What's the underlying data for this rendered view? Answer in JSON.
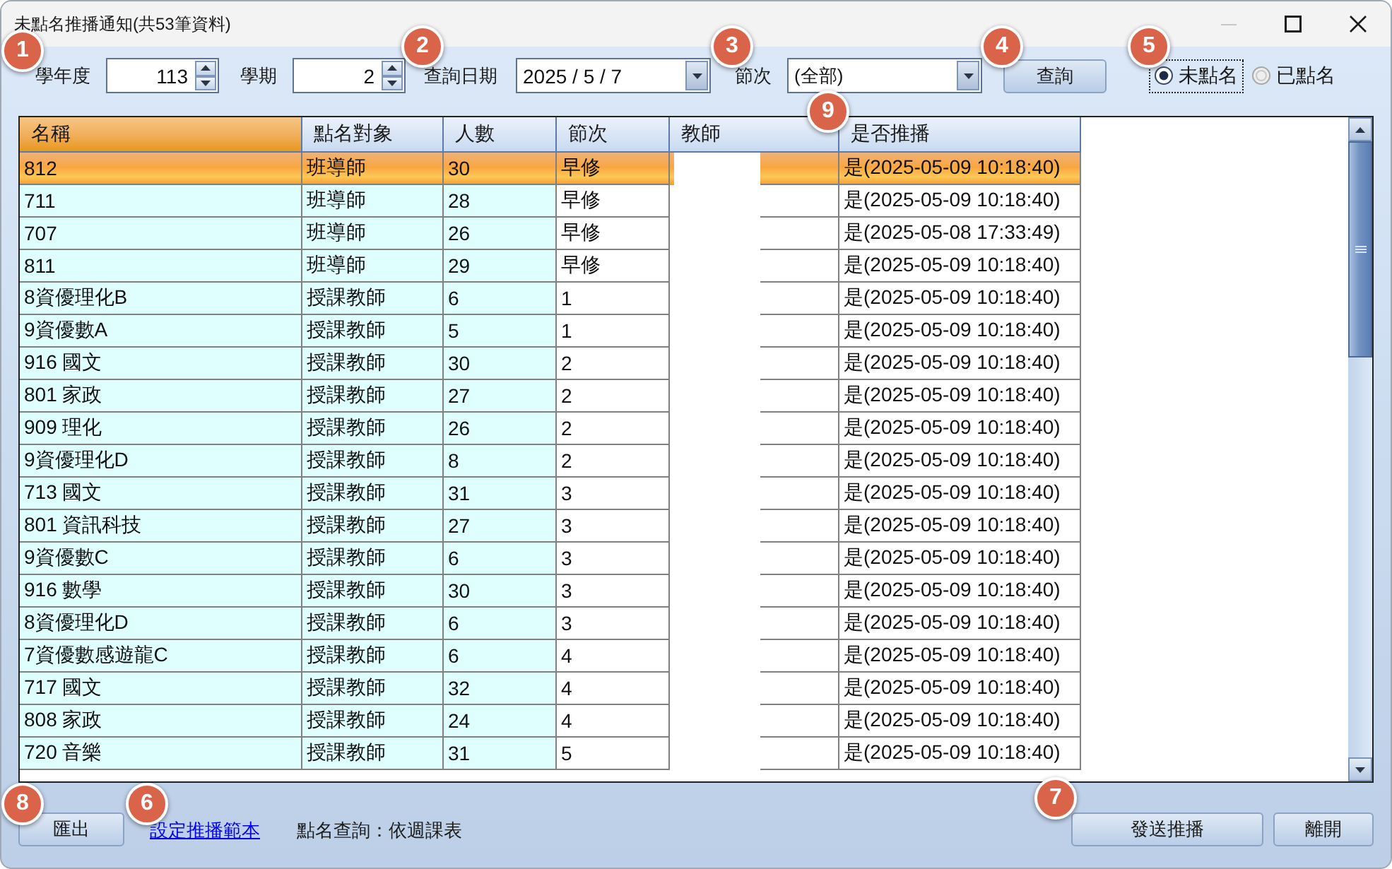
{
  "window": {
    "title": "未點名推播通知(共53筆資料)",
    "controls": [
      {
        "kind": "minimize",
        "disabled": true
      },
      {
        "kind": "maximize",
        "disabled": false
      },
      {
        "kind": "close",
        "disabled": false
      }
    ]
  },
  "filters": {
    "school_year": {
      "label": "學年度",
      "value": "113"
    },
    "semester": {
      "label": "學期",
      "value": "2"
    },
    "query_date": {
      "label": "查詢日期",
      "value": "2025 / 5 / 7"
    },
    "period": {
      "label": "節次",
      "value": "(全部)"
    },
    "query_button": "查詢",
    "view_options": [
      {
        "label": "未點名",
        "selected": true,
        "focused": true
      },
      {
        "label": "已點名",
        "selected": false,
        "focused": false
      }
    ]
  },
  "table": {
    "columns": [
      {
        "label": "名稱",
        "kind": "text",
        "active": true,
        "shaded": true
      },
      {
        "label": "點名對象",
        "kind": "text",
        "active": false,
        "shaded": true
      },
      {
        "label": "人數",
        "kind": "text",
        "active": false,
        "shaded": true
      },
      {
        "label": "節次",
        "kind": "text",
        "active": false,
        "shaded": false
      },
      {
        "label": "教師",
        "kind": "masked",
        "active": false,
        "shaded": false
      },
      {
        "label": "是否推播",
        "kind": "text",
        "active": false,
        "shaded": false
      }
    ],
    "rows": [
      {
        "selected": true,
        "cells": [
          "812",
          "班導師",
          "30",
          "早修",
          "是(2025-05-09 10:18:40)"
        ]
      },
      {
        "selected": false,
        "cells": [
          "711",
          "班導師",
          "28",
          "早修",
          "是(2025-05-09 10:18:40)"
        ]
      },
      {
        "selected": false,
        "cells": [
          "707",
          "班導師",
          "26",
          "早修",
          "是(2025-05-08 17:33:49)"
        ]
      },
      {
        "selected": false,
        "cells": [
          "811",
          "班導師",
          "29",
          "早修",
          "是(2025-05-09 10:18:40)"
        ]
      },
      {
        "selected": false,
        "cells": [
          "8資優理化B",
          "授課教師",
          "6",
          "1",
          "是(2025-05-09 10:18:40)"
        ]
      },
      {
        "selected": false,
        "cells": [
          "9資優數A",
          "授課教師",
          "5",
          "1",
          "是(2025-05-09 10:18:40)"
        ]
      },
      {
        "selected": false,
        "cells": [
          "916 國文",
          "授課教師",
          "30",
          "2",
          "是(2025-05-09 10:18:40)"
        ]
      },
      {
        "selected": false,
        "cells": [
          "801 家政",
          "授課教師",
          "27",
          "2",
          "是(2025-05-09 10:18:40)"
        ]
      },
      {
        "selected": false,
        "cells": [
          "909 理化",
          "授課教師",
          "26",
          "2",
          "是(2025-05-09 10:18:40)"
        ]
      },
      {
        "selected": false,
        "cells": [
          "9資優理化D",
          "授課教師",
          "8",
          "2",
          "是(2025-05-09 10:18:40)"
        ]
      },
      {
        "selected": false,
        "cells": [
          "713 國文",
          "授課教師",
          "31",
          "3",
          "是(2025-05-09 10:18:40)"
        ]
      },
      {
        "selected": false,
        "cells": [
          "801 資訊科技",
          "授課教師",
          "27",
          "3",
          "是(2025-05-09 10:18:40)"
        ]
      },
      {
        "selected": false,
        "cells": [
          "9資優數C",
          "授課教師",
          "6",
          "3",
          "是(2025-05-09 10:18:40)"
        ]
      },
      {
        "selected": false,
        "cells": [
          "916 數學",
          "授課教師",
          "30",
          "3",
          "是(2025-05-09 10:18:40)"
        ]
      },
      {
        "selected": false,
        "cells": [
          "8資優理化D",
          "授課教師",
          "6",
          "3",
          "是(2025-05-09 10:18:40)"
        ]
      },
      {
        "selected": false,
        "cells": [
          "7資優數感遊龍C",
          "授課教師",
          "6",
          "4",
          "是(2025-05-09 10:18:40)"
        ]
      },
      {
        "selected": false,
        "cells": [
          "717 國文",
          "授課教師",
          "32",
          "4",
          "是(2025-05-09 10:18:40)"
        ]
      },
      {
        "selected": false,
        "cells": [
          "808 家政",
          "授課教師",
          "24",
          "4",
          "是(2025-05-09 10:18:40)"
        ]
      },
      {
        "selected": false,
        "cells": [
          "720 音樂",
          "授課教師",
          "31",
          "5",
          "是(2025-05-09 10:18:40)"
        ]
      }
    ]
  },
  "footer": {
    "export_button": "匯出",
    "template_link": "設定推播範本",
    "mode_text": "點名查詢：依週課表",
    "send_button": "發送推播",
    "close_button": "離開"
  },
  "callouts": [
    {
      "label": "1"
    },
    {
      "label": "2"
    },
    {
      "label": "3"
    },
    {
      "label": "4"
    },
    {
      "label": "5"
    },
    {
      "label": "9"
    },
    {
      "label": "8"
    },
    {
      "label": "6"
    },
    {
      "label": "7"
    }
  ]
}
